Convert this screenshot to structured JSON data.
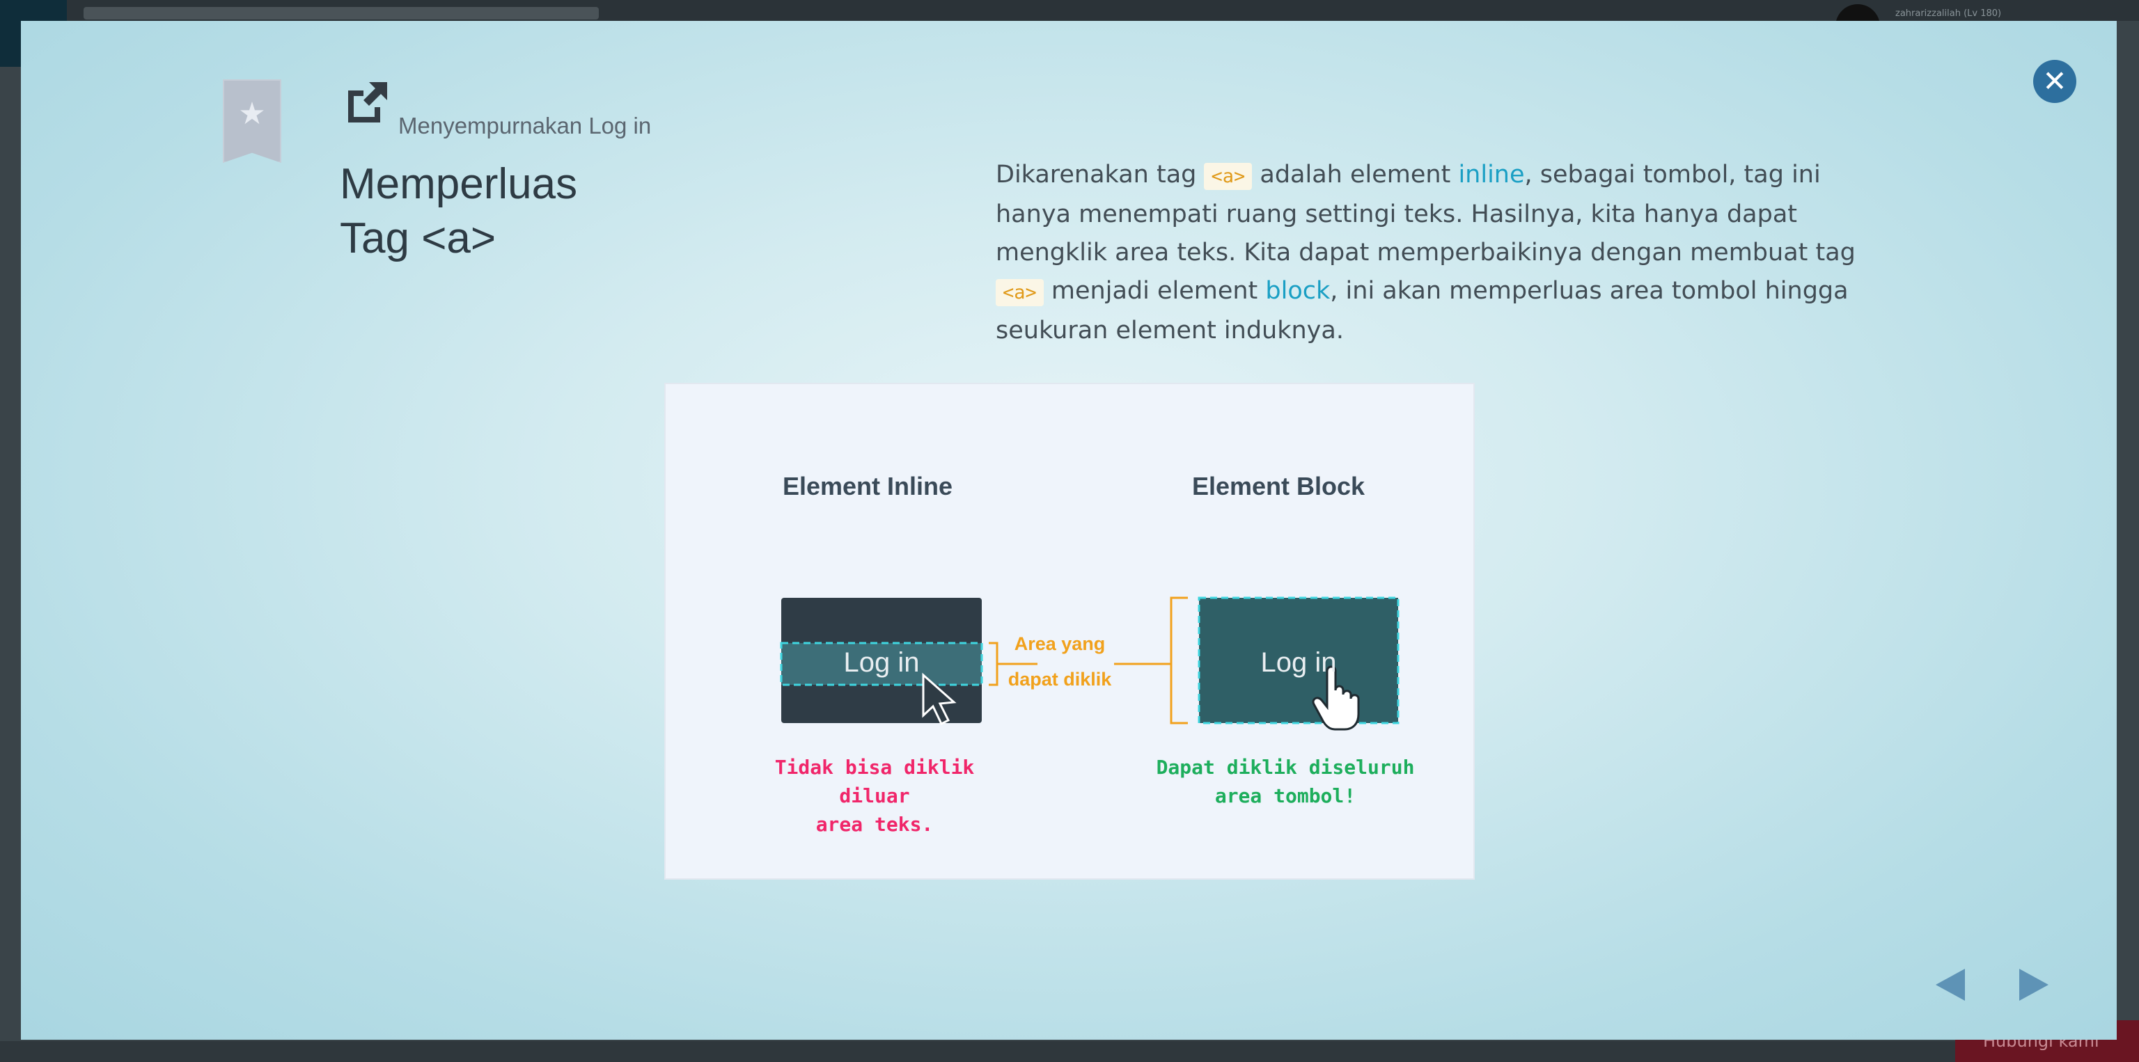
{
  "background": {
    "user_label": "zahrarizzalilah (Lv 180)",
    "hubungi_label": "Hubungi kami"
  },
  "modal": {
    "section_title": "Menyempurnakan Log in",
    "title_line1": "Memperluas",
    "title_line2": "Tag <a>",
    "paragraph": {
      "p1": "Dikarenakan tag ",
      "code1": "<a>",
      "p2": " adalah element ",
      "kw_inline": "inline",
      "p3": ", sebagai tombol, tag ini hanya menempati ruang settingi teks. Hasilnya, kita hanya dapat mengklik area teks. Kita dapat memperbaikinya dengan membuat tag ",
      "code2": "<a>",
      "p4": " menjadi element ",
      "kw_block": "block",
      "p5": ", ini akan memperluas area tombol hingga seukuran element induknya."
    },
    "illustration": {
      "heading_inline": "Element Inline",
      "heading_block": "Element Block",
      "button_label_inline": "Log in",
      "button_label_block": "Log in",
      "area_label_line1": "Area yang",
      "area_label_line2": "dapat diklik",
      "caption_inline_line1": "Tidak bisa diklik diluar",
      "caption_inline_line2": "area teks.",
      "caption_block_line1": "Dapat diklik diseluruh",
      "caption_block_line2": "area tombol!"
    },
    "icons": {
      "bookmark": "bookmark-star-icon",
      "external_link": "external-link-icon",
      "close": "close-icon",
      "prev": "chevron-left-icon",
      "next": "chevron-right-icon"
    },
    "colors": {
      "accent_blue": "#1a9fc4",
      "code_orange": "#e09a1a",
      "red_caption": "#f0266a",
      "green_caption": "#1dae5c",
      "nav_blue": "#5e93b6"
    }
  }
}
